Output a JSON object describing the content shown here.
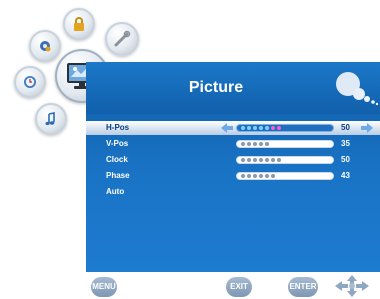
{
  "menu": {
    "title": "Picture",
    "items": [
      {
        "label": "H-Pos",
        "value": "50",
        "level": 50
      },
      {
        "label": "V-Pos",
        "value": "35",
        "level": 35
      },
      {
        "label": "Clock",
        "value": "50",
        "level": 50
      },
      {
        "label": "Phase",
        "value": "43",
        "level": 43
      },
      {
        "label": "Auto"
      }
    ]
  },
  "footer": {
    "menu_label": "MENU",
    "exit_label": "EXIT",
    "enter_label": "ENTER"
  },
  "icons": {
    "picture": "monitor-icon",
    "lock": "lock-icon",
    "settings": "gear-icon",
    "tools": "tools-icon",
    "time": "clock-icon",
    "audio": "music-note-icon"
  },
  "colors": {
    "panel": "#1a74c6",
    "selected": "#ffffff",
    "accent": "#ff5cc8"
  }
}
